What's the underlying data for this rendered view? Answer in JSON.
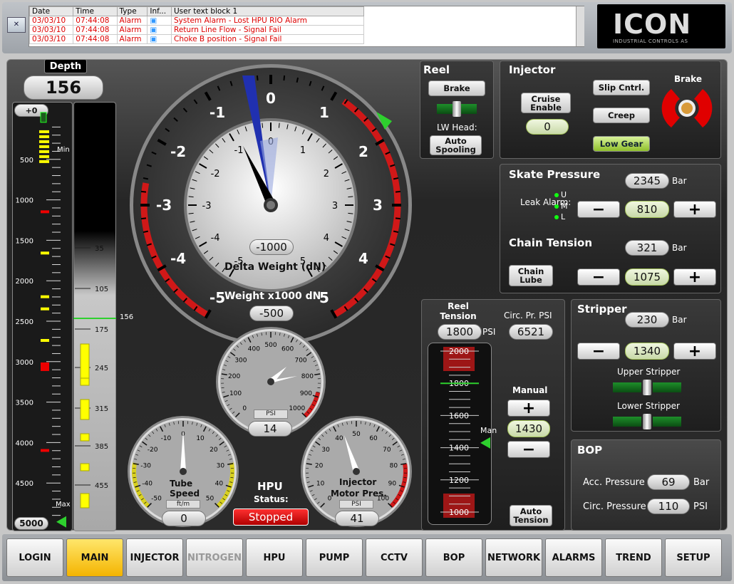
{
  "alarms": {
    "columns": [
      "Date",
      "Time",
      "Type",
      "Inf...",
      "User text block 1"
    ],
    "rows": [
      {
        "date": "03/03/10",
        "time": "07:44:08",
        "type": "Alarm",
        "text": "System Alarm - Lost HPU RIO Alarm"
      },
      {
        "date": "03/03/10",
        "time": "07:44:08",
        "type": "Alarm",
        "text": "Return Line Flow - Signal Fail"
      },
      {
        "date": "03/03/10",
        "time": "07:44:08",
        "type": "Alarm",
        "text": "Choke B position - Signal Fail"
      }
    ]
  },
  "logo": {
    "name": "ICON",
    "sub": "INDUSTRIAL CONTROLS AS"
  },
  "depth": {
    "title": "Depth",
    "value": "156",
    "top_label": "+0",
    "bottom_label": "5000",
    "min_label": "Min",
    "max_label": "Max",
    "scale": [
      "500",
      "1000",
      "1500",
      "2000",
      "2500",
      "3000",
      "3500",
      "4000",
      "4500"
    ],
    "inner_scale": [
      "35",
      "105",
      "175",
      "245",
      "315",
      "385",
      "455"
    ],
    "marker": "156"
  },
  "weight": {
    "outer_ticks": [
      "-5",
      "-4",
      "-3",
      "-2",
      "-1",
      "0",
      "1",
      "2",
      "3",
      "4",
      "5"
    ],
    "inner_ticks": [
      "-5",
      "-4",
      "-3",
      "-2",
      "-1",
      "0",
      "1",
      "2",
      "3",
      "4",
      "5"
    ],
    "inner_title": "Delta Weight (dN)",
    "inner_value": "-1000",
    "title": "Weight x1000 dN",
    "value": "-500"
  },
  "psi_gauge": {
    "ticks": [
      "0",
      "100",
      "200",
      "300",
      "400",
      "500",
      "600",
      "700",
      "800",
      "900",
      "1000"
    ],
    "unit": "PSI",
    "value": "14"
  },
  "tube_speed": {
    "ticks": [
      "-50",
      "-40",
      "-30",
      "-20",
      "-10",
      "0",
      "10",
      "20",
      "30",
      "40",
      "50"
    ],
    "title1": "Tube",
    "title2": "Speed",
    "unit": "ft/m",
    "value": "0"
  },
  "inj_motor": {
    "ticks": [
      "0",
      "10",
      "20",
      "30",
      "40",
      "50",
      "60",
      "70",
      "80",
      "90",
      "100"
    ],
    "title1": "Injector",
    "title2": "Motor Pres.",
    "unit": "PSI",
    "value": "41"
  },
  "hpu": {
    "title": "HPU",
    "status_label": "Status:",
    "status": "Stopped"
  },
  "reel": {
    "title": "Reel",
    "brake": "Brake",
    "lw_head": "LW Head:",
    "auto_spooling": "Auto Spooling"
  },
  "injector": {
    "title": "Injector",
    "cruise": "Cruise Enable",
    "cruise_value": "0",
    "slip": "Slip Cntrl.",
    "creep": "Creep",
    "low_gear": "Low Gear",
    "brake": "Brake"
  },
  "skate": {
    "title": "Skate Pressure",
    "value": "2345",
    "unit": "Bar",
    "leak": "Leak Alarm:",
    "u": "U",
    "m": "M",
    "l": "L",
    "set": "810",
    "minus": "−",
    "plus": "+"
  },
  "chain": {
    "title": "Chain Tension",
    "value": "321",
    "unit": "Bar",
    "lube": "Chain Lube",
    "set": "1075"
  },
  "reel_tension": {
    "title": "Reel Tension",
    "value": "1800",
    "unit": "PSI",
    "circ_label": "Circ. Pr. PSI",
    "circ_value": "6521",
    "scale": [
      "2000",
      "1800",
      "1600",
      "1400",
      "1200",
      "1000"
    ],
    "man": "Man",
    "manual": "Manual",
    "manual_value": "1430",
    "auto": "Auto Tension"
  },
  "stripper": {
    "title": "Stripper",
    "value": "230",
    "unit": "Bar",
    "set": "1340",
    "upper": "Upper Stripper",
    "lower": "Lower Stripper"
  },
  "bop": {
    "title": "BOP",
    "acc_label": "Acc. Pressure",
    "acc_value": "69",
    "acc_unit": "Bar",
    "circ_label": "Circ. Pressure",
    "circ_value": "110",
    "circ_unit": "PSI"
  },
  "nav": [
    "LOGIN",
    "MAIN",
    "INJECTOR",
    "NITROGEN",
    "HPU",
    "PUMP",
    "CCTV",
    "BOP",
    "NETWORK",
    "ALARMS",
    "TREND",
    "SETUP"
  ],
  "nav_active": 1,
  "nav_disabled": 3,
  "icons": {
    "mute": "mute-alarm-icon",
    "brake": "brake-indicator-icon"
  }
}
